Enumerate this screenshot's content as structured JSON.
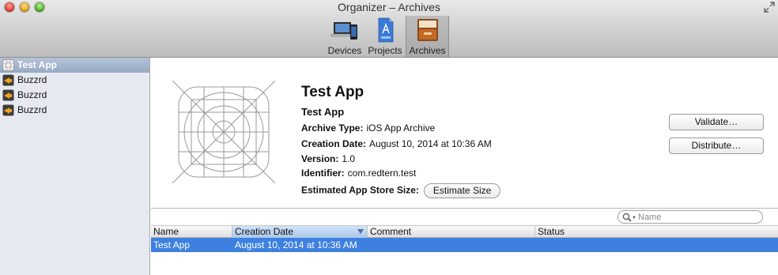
{
  "window": {
    "title": "Organizer – Archives",
    "fullscreen_icon": "fullscreen-arrows-icon"
  },
  "toolbar": {
    "items": [
      {
        "label": "Devices",
        "icon": "devices-icon"
      },
      {
        "label": "Projects",
        "icon": "projects-icon"
      },
      {
        "label": "Archives",
        "icon": "archives-icon",
        "selected": true
      }
    ]
  },
  "sidebar": {
    "items": [
      {
        "label": "Test App",
        "icon": "app-grid-icon",
        "selected": true
      },
      {
        "label": "Buzzrd",
        "icon": "buzzrd-app-icon"
      },
      {
        "label": "Buzzrd",
        "icon": "buzzrd-app-icon"
      },
      {
        "label": "Buzzrd",
        "icon": "buzzrd-app-icon"
      }
    ]
  },
  "details": {
    "title": "Test App",
    "subtitle": "Test App",
    "archive_type_label": "Archive Type:",
    "archive_type_value": "iOS App Archive",
    "creation_date_label": "Creation Date:",
    "creation_date_value": "August 10, 2014 at 10:36 AM",
    "version_label": "Version:",
    "version_value": "1.0",
    "identifier_label": "Identifier:",
    "identifier_value": "com.redtern.test",
    "size_label": "Estimated App Store Size:",
    "estimate_button": "Estimate Size",
    "validate_button": "Validate…",
    "distribute_button": "Distribute…"
  },
  "search": {
    "placeholder": "Name",
    "value": ""
  },
  "table": {
    "columns": [
      "Name",
      "Creation Date",
      "Comment",
      "Status"
    ],
    "sorted_column": "Creation Date",
    "rows": [
      {
        "name": "Test App",
        "creation_date": "August 10, 2014 at 10:36 AM",
        "comment": "",
        "status": "",
        "selected": true
      }
    ]
  },
  "colors": {
    "selection_blue": "#3d80df",
    "sidebar_bg": "#e6eaf0",
    "sidebar_selected": "#98aac3"
  }
}
